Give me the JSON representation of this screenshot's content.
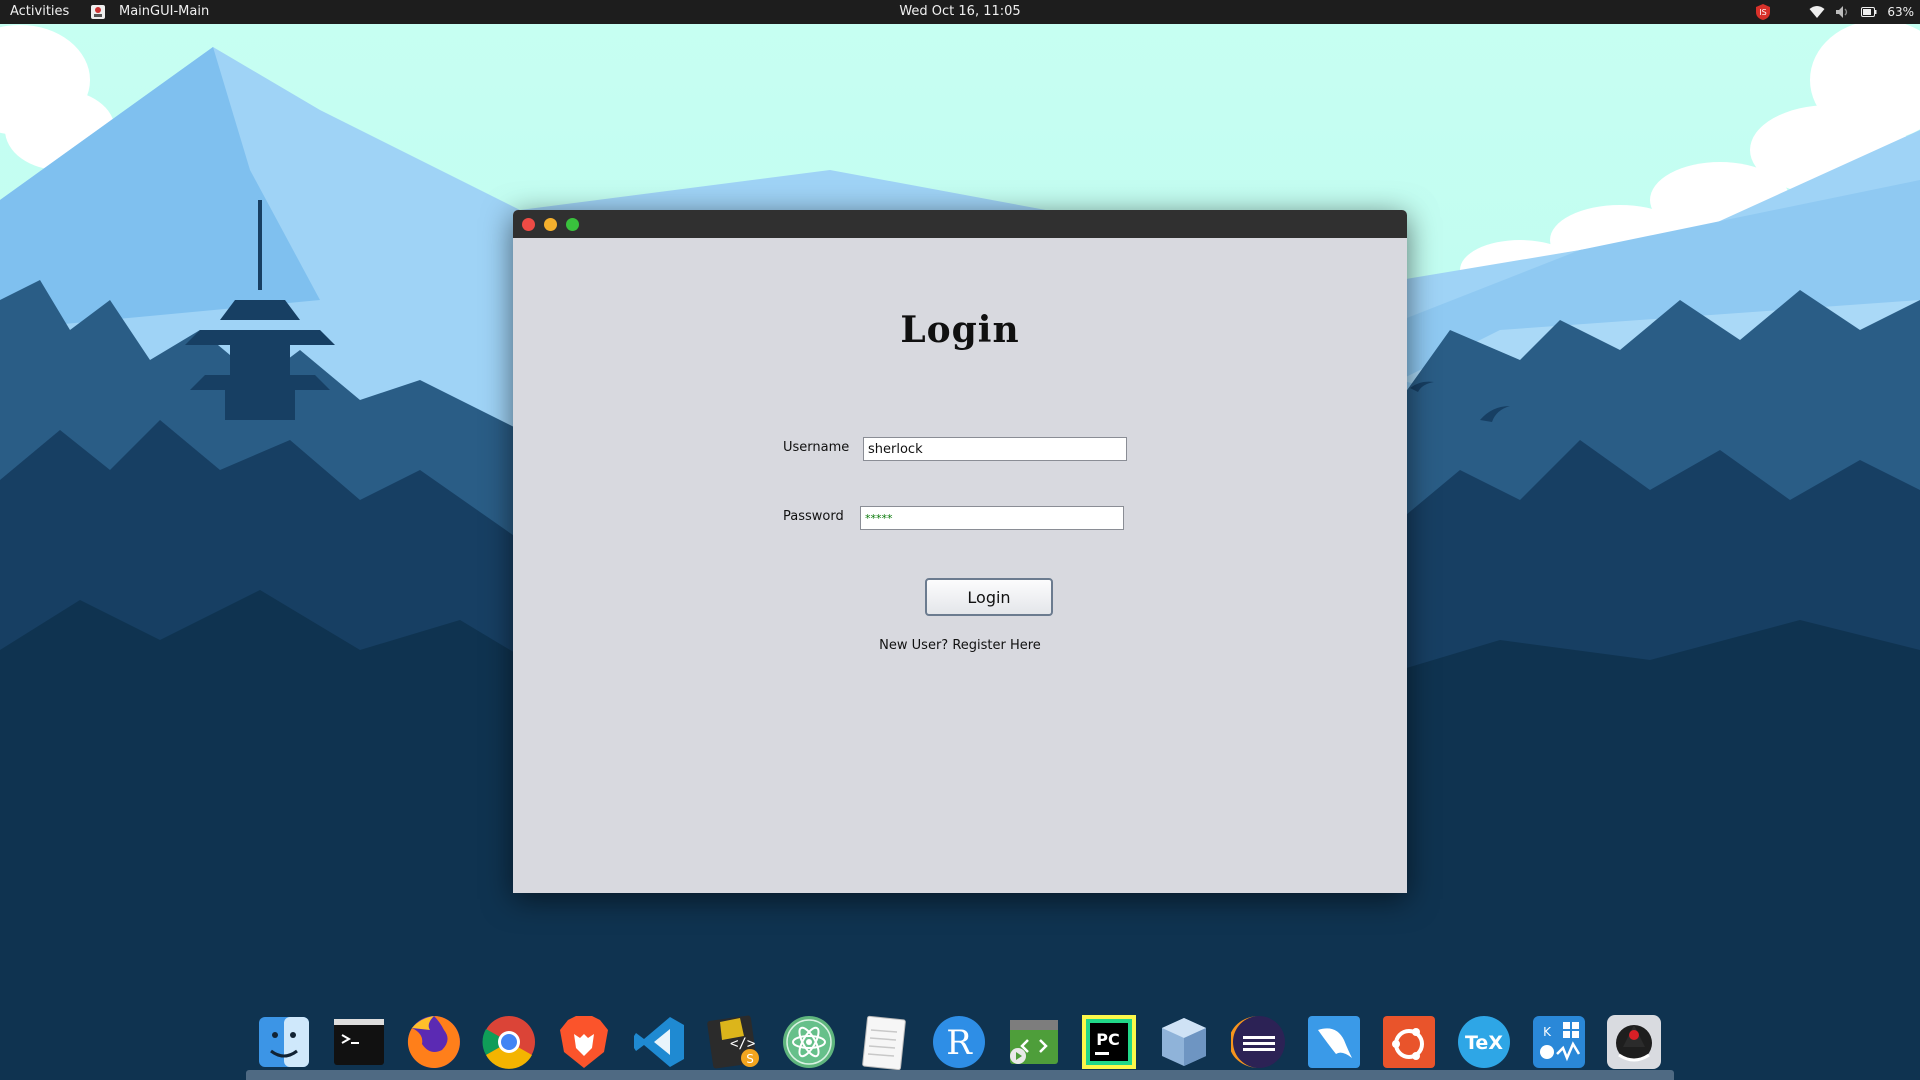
{
  "topbar": {
    "activities": "Activities",
    "app_name": "MainGUI-Main",
    "clock": "Wed Oct 16, 11:05",
    "battery": "63%"
  },
  "window": {
    "title": "Login",
    "username_label": "Username",
    "username_value": "sherlock",
    "password_label": "Password",
    "password_value": "*****",
    "login_button": "Login",
    "register_link": "New User? Register Here",
    "traffic_lights": {
      "close": "#ee4b45",
      "minimize": "#f5b02d",
      "maximize": "#39c13d"
    }
  },
  "dock": {
    "apps": [
      {
        "name": "finder-icon",
        "r": "Finder"
      },
      {
        "name": "terminal-icon"
      },
      {
        "name": "firefox-icon"
      },
      {
        "name": "chrome-icon"
      },
      {
        "name": "brave-icon"
      },
      {
        "name": "vscode-icon"
      },
      {
        "name": "sublime-icon"
      },
      {
        "name": "atom-icon"
      },
      {
        "name": "text-editor-icon"
      },
      {
        "name": "r-icon"
      },
      {
        "name": "code-runner-icon"
      },
      {
        "name": "pycharm-icon"
      },
      {
        "name": "virtualbox-icon"
      },
      {
        "name": "eclipse-icon"
      },
      {
        "name": "mysql-icon"
      },
      {
        "name": "ubuntu-software-icon"
      },
      {
        "name": "tex-icon"
      },
      {
        "name": "multi-os-icon"
      },
      {
        "name": "java-app-icon"
      }
    ],
    "r_label": "R",
    "tex_label": "TeX",
    "pc_label": "PC"
  }
}
